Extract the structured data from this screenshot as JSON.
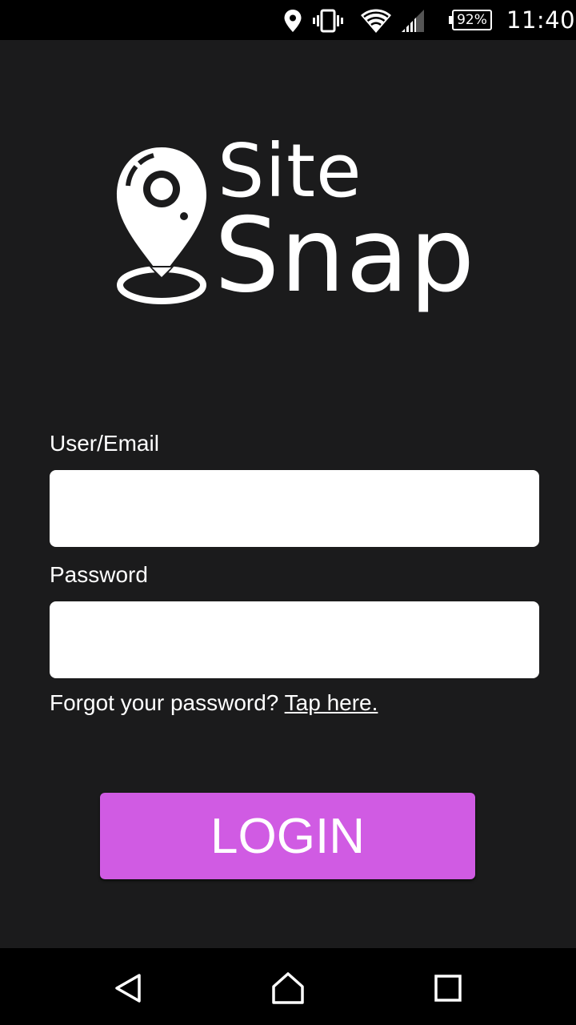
{
  "status_bar": {
    "battery_percent": "92%",
    "time": "11:40",
    "icons": [
      "location-icon",
      "vibrate-icon",
      "wifi-icon",
      "cell-signal-icon",
      "battery-icon"
    ]
  },
  "logo": {
    "line1": "Site",
    "line2": "Snap"
  },
  "form": {
    "user_label": "User/Email",
    "user_value": "",
    "password_label": "Password",
    "password_value": "",
    "forgot_text": "Forgot your password?",
    "forgot_link": "Tap here.",
    "login_label": "LOGIN"
  },
  "nav_bar": {
    "icons": [
      "back-icon",
      "home-icon",
      "recents-icon"
    ]
  },
  "colors": {
    "background": "#1b1b1c",
    "accent": "#d05be3",
    "input_bg": "#ffffff",
    "bars": "#000000"
  }
}
